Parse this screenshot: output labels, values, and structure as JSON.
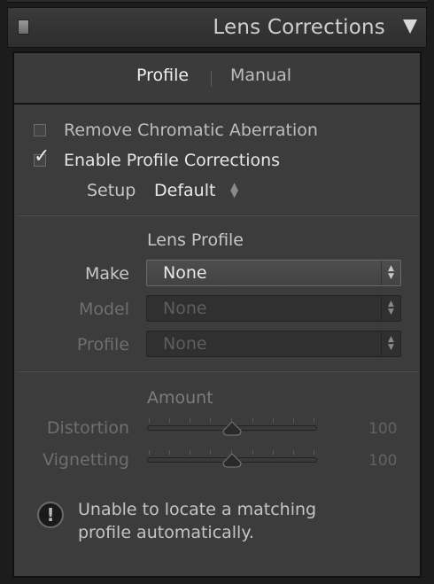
{
  "header": {
    "title": "Lens Corrections"
  },
  "tabs": [
    {
      "label": "Profile",
      "active": true
    },
    {
      "label": "Manual",
      "active": false
    }
  ],
  "options": {
    "remove_ca": {
      "label": "Remove Chromatic Aberration",
      "checked": false
    },
    "enable_profile": {
      "label": "Enable Profile Corrections",
      "checked": true
    },
    "checkmark_glyph": "✓"
  },
  "setup": {
    "label": "Setup",
    "value": "Default"
  },
  "lens_profile": {
    "title": "Lens Profile",
    "make": {
      "label": "Make",
      "value": "None",
      "enabled": true
    },
    "model": {
      "label": "Model",
      "value": "None",
      "enabled": false
    },
    "profile": {
      "label": "Profile",
      "value": "None",
      "enabled": false
    }
  },
  "amount": {
    "title": "Amount",
    "distortion": {
      "label": "Distortion",
      "value": "100"
    },
    "vignetting": {
      "label": "Vignetting",
      "value": "100"
    }
  },
  "warning": {
    "glyph": "!",
    "line1": "Unable to locate a matching",
    "line2": "profile automatically."
  },
  "colors": {
    "panel_bg": "#3c3c3c",
    "header_bg": "#333333",
    "text_active": "#e8e8e8",
    "text_disabled": "#6f6f6f"
  }
}
